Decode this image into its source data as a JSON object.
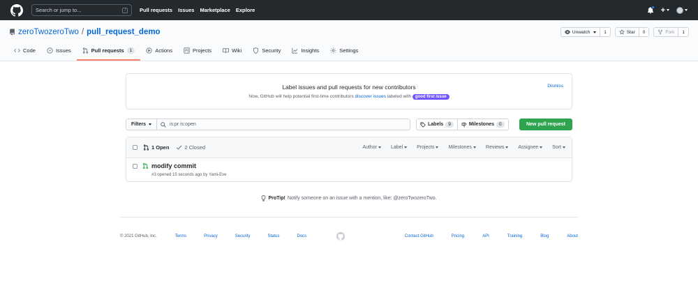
{
  "topbar": {
    "search_placeholder": "Search or jump to...",
    "slash": "/",
    "nav": [
      "Pull requests",
      "Issues",
      "Marketplace",
      "Explore"
    ],
    "plus": "+"
  },
  "repo": {
    "owner": "zeroTwozeroTwo",
    "sep": "/",
    "name": "pull_request_demo",
    "watch_label": "Unwatch",
    "watch_count": "1",
    "star_label": "Star",
    "star_count": "0",
    "fork_label": "Fork",
    "fork_count": "1"
  },
  "tabs": [
    {
      "label": "Code",
      "icon": "code-icon"
    },
    {
      "label": "Issues",
      "icon": "issue-icon"
    },
    {
      "label": "Pull requests",
      "icon": "pull-request-icon",
      "count": "1",
      "selected": true
    },
    {
      "label": "Actions",
      "icon": "play-icon"
    },
    {
      "label": "Projects",
      "icon": "project-icon"
    },
    {
      "label": "Wiki",
      "icon": "book-icon"
    },
    {
      "label": "Security",
      "icon": "shield-icon"
    },
    {
      "label": "Insights",
      "icon": "graph-icon"
    },
    {
      "label": "Settings",
      "icon": "gear-icon"
    }
  ],
  "banner": {
    "title": "Label issues and pull requests for new contributors",
    "text_before": "Now, GitHub will help potential first-time contributors",
    "link": "discover issues",
    "text_after": "labeled with",
    "label": "good first issue",
    "dismiss": "Dismiss"
  },
  "filterbar": {
    "filters": "Filters",
    "query": "is:pr is:open",
    "labels": "Labels",
    "labels_count": "9",
    "milestones": "Milestones",
    "milestones_count": "0",
    "new_pr": "New pull request"
  },
  "list": {
    "open": "1 Open",
    "closed": "2 Closed",
    "sorts": [
      "Author",
      "Label",
      "Projects",
      "Milestones",
      "Reviews",
      "Assignee",
      "Sort"
    ],
    "items": [
      {
        "title": "modify commit",
        "meta": "#3 opened 15 seconds ago by Yami-Eve"
      }
    ]
  },
  "protip": {
    "bold": "ProTip!",
    "text": "Notify someone on an issue with a mention, like: @zeroTwozeroTwo."
  },
  "footer": {
    "copyright": "© 2021 GitHub, Inc.",
    "left_links": [
      "Terms",
      "Privacy",
      "Security",
      "Status",
      "Docs"
    ],
    "right_links": [
      "Contact GitHub",
      "Pricing",
      "API",
      "Training",
      "Blog",
      "About"
    ]
  },
  "colors": {
    "topbar": "#24292e",
    "link": "#0366d6",
    "green": "#2ea44f",
    "tab_underline": "#f9826c",
    "good_first_issue": "#7057ff"
  }
}
